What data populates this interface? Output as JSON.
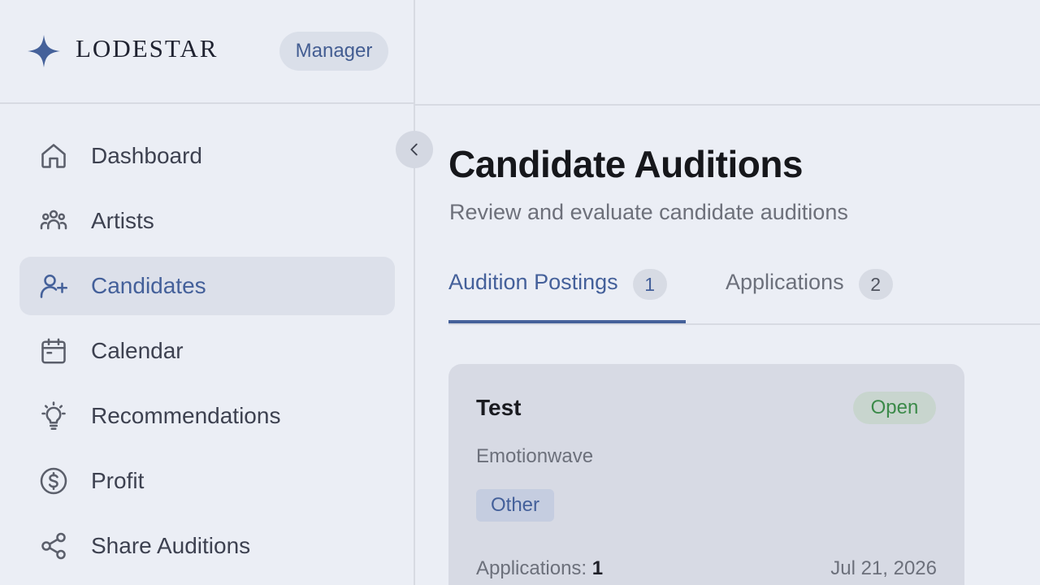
{
  "brand": {
    "name": "LODESTAR",
    "role": "Manager",
    "logo_icon": "four-point-star-icon",
    "accent_color": "#45619a"
  },
  "sidebar": {
    "items": [
      {
        "label": "Dashboard",
        "icon": "home-icon",
        "active": false
      },
      {
        "label": "Artists",
        "icon": "users-icon",
        "active": false
      },
      {
        "label": "Candidates",
        "icon": "user-plus-icon",
        "active": true
      },
      {
        "label": "Calendar",
        "icon": "calendar-icon",
        "active": false
      },
      {
        "label": "Recommendations",
        "icon": "lightbulb-icon",
        "active": false
      },
      {
        "label": "Profit",
        "icon": "dollar-circle-icon",
        "active": false
      },
      {
        "label": "Share Auditions",
        "icon": "share-icon",
        "active": false
      }
    ],
    "collapse_icon": "chevron-left-icon"
  },
  "page": {
    "title": "Candidate Auditions",
    "subtitle": "Review and evaluate candidate auditions"
  },
  "tabs": [
    {
      "label": "Audition Postings",
      "count": "1",
      "active": true
    },
    {
      "label": "Applications",
      "count": "2",
      "active": false
    }
  ],
  "postings": [
    {
      "title": "Test",
      "status": "Open",
      "status_color": "#3b8a49",
      "company": "Emotionwave",
      "tag": "Other",
      "applications_label": "Applications:",
      "applications_count": "1",
      "date": "Jul 21, 2026"
    }
  ]
}
